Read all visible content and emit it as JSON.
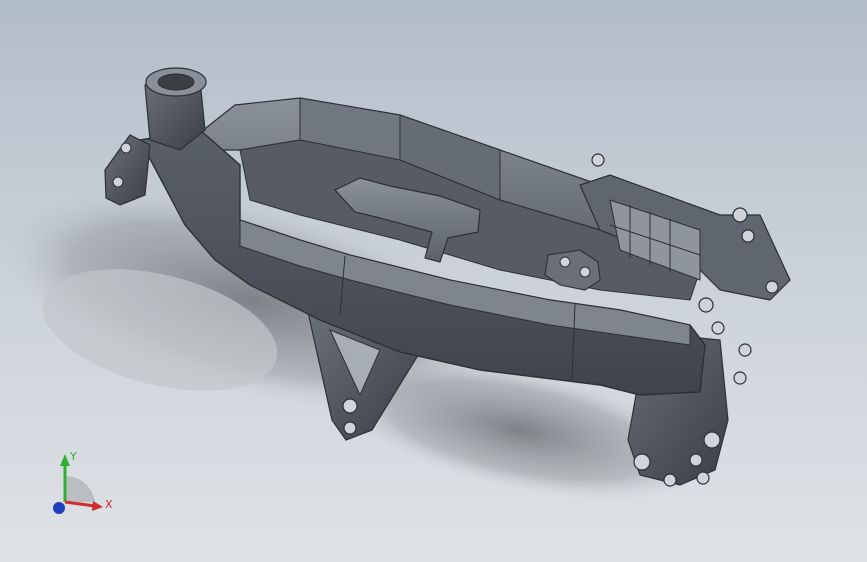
{
  "viewport": {
    "model_icon": "motorcycle-frame-model",
    "background_top": "#b2bdca",
    "background_bottom": "#dfe2e6"
  },
  "triad": {
    "y_label": "Y",
    "x_label": "X",
    "y_color": "#2fae2f",
    "x_color": "#d22b2b",
    "z_color": "#1f3fbf"
  }
}
